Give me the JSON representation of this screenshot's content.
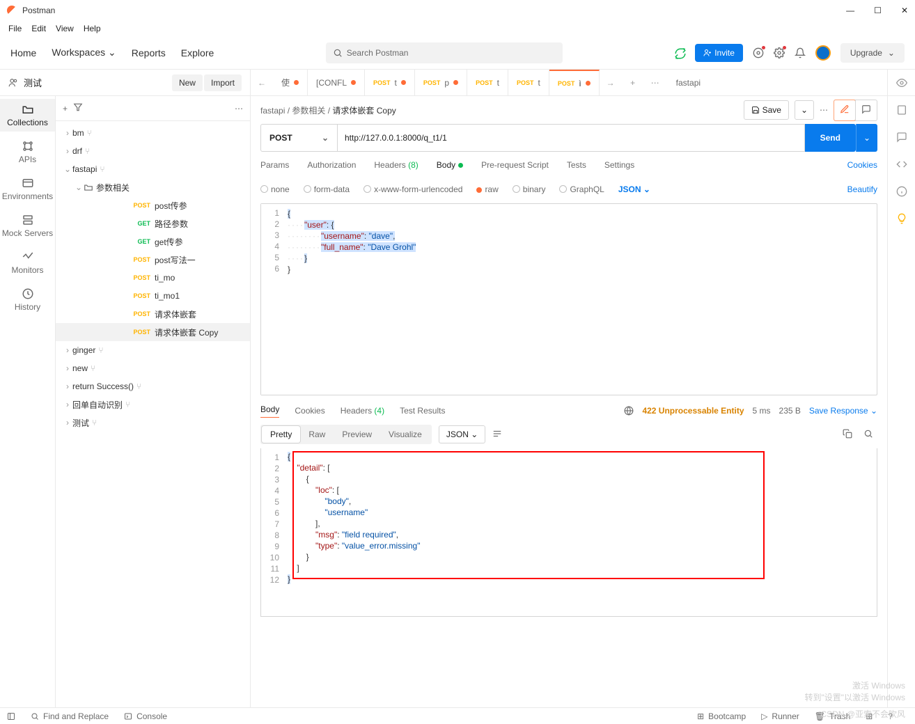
{
  "title": {
    "app": "Postman"
  },
  "menu": {
    "file": "File",
    "edit": "Edit",
    "view": "View",
    "help": "Help"
  },
  "header": {
    "home": "Home",
    "workspaces": "Workspaces",
    "reports": "Reports",
    "explore": "Explore",
    "search_placeholder": "Search Postman",
    "invite": "Invite",
    "upgrade": "Upgrade"
  },
  "workspace": {
    "name": "测试",
    "new": "New",
    "import": "Import"
  },
  "tabs": [
    {
      "method": "",
      "label": "使",
      "dirty": true
    },
    {
      "method": "",
      "label": "[CONFL",
      "dirty": true
    },
    {
      "method": "POST",
      "label": "t",
      "dirty": true
    },
    {
      "method": "POST",
      "label": "p",
      "dirty": true
    },
    {
      "method": "POST",
      "label": "t",
      "dirty": false
    },
    {
      "method": "POST",
      "label": "t",
      "dirty": false
    },
    {
      "method": "POST",
      "label": "ì",
      "dirty": true
    }
  ],
  "env": "fastapi",
  "rail": {
    "collections": "Collections",
    "apis": "APIs",
    "envs": "Environments",
    "mock": "Mock Servers",
    "monitors": "Monitors",
    "history": "History"
  },
  "tree": {
    "bm": "bm",
    "drf": "drf",
    "fastapi": "fastapi",
    "folder": "参数相关",
    "items": [
      {
        "method": "POST",
        "label": "post传参"
      },
      {
        "method": "GET",
        "label": "路径参数"
      },
      {
        "method": "GET",
        "label": "get传参"
      },
      {
        "method": "POST",
        "label": "post写法一"
      },
      {
        "method": "POST",
        "label": "ti_mo"
      },
      {
        "method": "POST",
        "label": "ti_mo1"
      },
      {
        "method": "POST",
        "label": "请求体嵌套"
      },
      {
        "method": "POST",
        "label": "请求体嵌套 Copy"
      }
    ],
    "ginger": "ginger",
    "new": "new",
    "returnSuccess": "return Success()",
    "huidan": "回单自动识别",
    "ceshi": "测试"
  },
  "breadcrumb": {
    "a": "fastapi",
    "b": "参数相关",
    "c": "请求体嵌套 Copy"
  },
  "actions": {
    "save": "Save"
  },
  "request": {
    "method": "POST",
    "url": "http://127.0.0.1:8000/q_t1/1",
    "send": "Send",
    "tabs": {
      "params": "Params",
      "auth": "Authorization",
      "headers": "Headers",
      "headers_n": "(8)",
      "body": "Body",
      "prerequest": "Pre-request Script",
      "tests": "Tests",
      "settings": "Settings",
      "cookies": "Cookies"
    },
    "body_types": {
      "none": "none",
      "form": "form-data",
      "urlenc": "x-www-form-urlencoded",
      "raw": "raw",
      "binary": "binary",
      "graphql": "GraphQL",
      "json": "JSON",
      "beautify": "Beautify"
    },
    "body_lines": {
      "l1": "{",
      "l2a": "\"user\"",
      "l2b": ": ",
      "l2c": "{",
      "l3a": "\"username\"",
      "l3b": ": ",
      "l3c": "\"dave\"",
      "l3d": ",",
      "l4a": "\"full_name\"",
      "l4b": ": ",
      "l4c": "\"Dave Grohl\"",
      "l5": "}",
      "l6": "}"
    }
  },
  "response": {
    "tabs": {
      "body": "Body",
      "cookies": "Cookies",
      "headers": "Headers",
      "headers_n": "(4)",
      "tests": "Test Results"
    },
    "status": "422 Unprocessable Entity",
    "time": "5 ms",
    "size": "235 B",
    "save": "Save Response",
    "modes": {
      "pretty": "Pretty",
      "raw": "Raw",
      "preview": "Preview",
      "visualize": "Visualize",
      "lang": "JSON"
    },
    "lines": {
      "l1": "{",
      "l2a": "\"detail\"",
      "l2b": ": [",
      "l3": "{",
      "l4a": "\"loc\"",
      "l4b": ": [",
      "l5a": "\"body\"",
      "l5b": ",",
      "l6a": "\"username\"",
      "l7": "],",
      "l8a": "\"msg\"",
      "l8b": ": ",
      "l8c": "\"field required\"",
      "l8d": ",",
      "l9a": "\"type\"",
      "l9b": ": ",
      "l9c": "\"value_error.missing\"",
      "l10": "}",
      "l11": "]",
      "l12": "}"
    }
  },
  "status": {
    "find": "Find and Replace",
    "console": "Console",
    "boot": "Bootcamp",
    "runner": "Runner",
    "trash": "Trash"
  },
  "wm": {
    "main": "激活 Windows",
    "sub": "转到\"设置\"以激活 Windows"
  },
  "csdn": "CSDN @亚索不会吹风"
}
